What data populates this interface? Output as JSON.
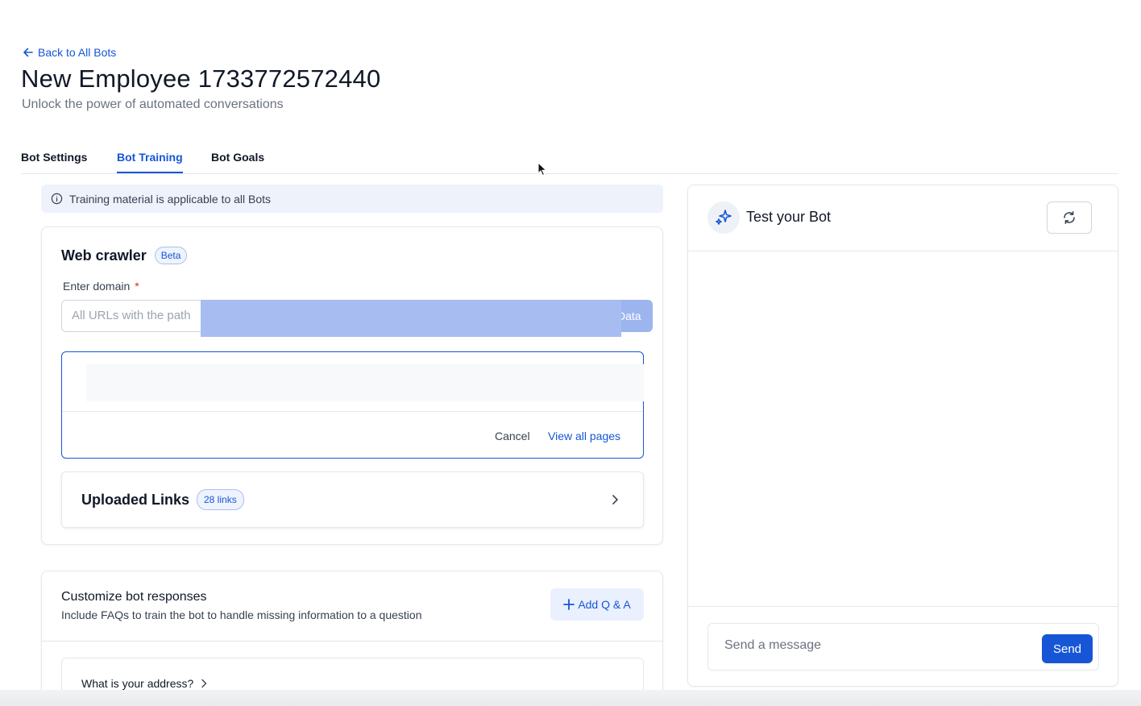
{
  "header": {
    "back_label": "Back to All Bots",
    "title": "New Employee 1733772572440",
    "subtitle": "Unlock the power of automated conversations"
  },
  "tabs": [
    {
      "label": "Bot Settings",
      "active": false
    },
    {
      "label": "Bot Training",
      "active": true
    },
    {
      "label": "Bot Goals",
      "active": false
    }
  ],
  "info_banner": {
    "icon": "info-icon",
    "text": "Training material is applicable to all Bots"
  },
  "web_crawler": {
    "title": "Web crawler",
    "badge": "Beta",
    "domain_label": "Enter domain",
    "required_mark": "*",
    "select_value": "All URLs with the path",
    "fetch_button_visible": "Data",
    "pages_panel": {
      "cancel_label": "Cancel",
      "view_all_label": "View all pages"
    },
    "uploaded_links": {
      "title": "Uploaded Links",
      "badge": "28 links"
    }
  },
  "customize": {
    "title": "Customize bot responses",
    "description": "Include FAQs to train the bot to handle missing information to a question",
    "add_button": "Add Q & A",
    "faq": [
      {
        "question": "What is your address?"
      }
    ]
  },
  "chat": {
    "title": "Test your Bot",
    "input_placeholder": "Send a message",
    "send_label": "Send"
  },
  "colors": {
    "accent": "#1656d6",
    "selection_highlight": "#a7bdf2",
    "banner_bg": "#eef2fb"
  }
}
